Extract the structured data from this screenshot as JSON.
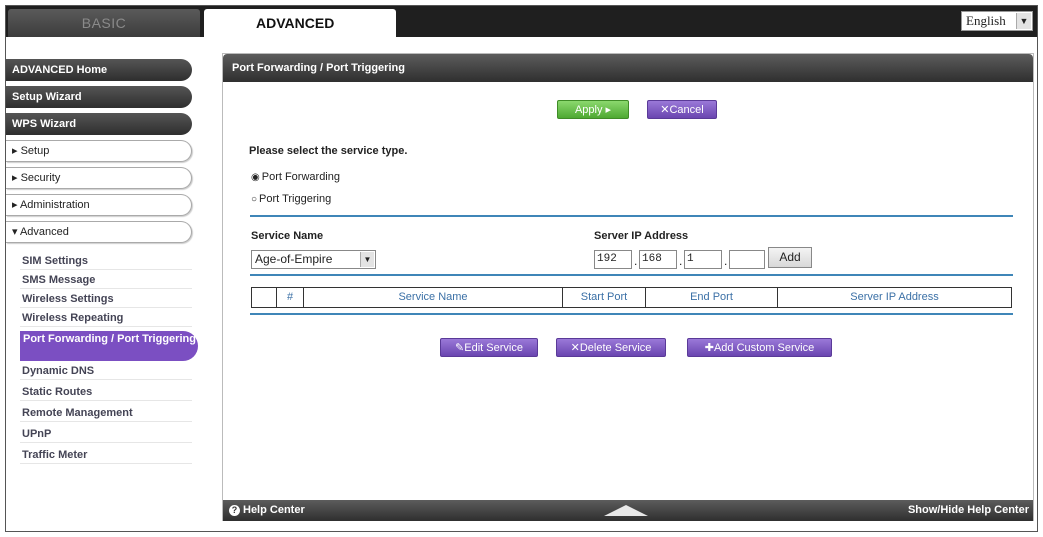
{
  "tabs": {
    "basic": "BASIC",
    "advanced": "ADVANCED"
  },
  "language": {
    "selected": "English",
    "arrow": "▼"
  },
  "sidebar": {
    "main_items": [
      "ADVANCED Home",
      "Setup Wizard",
      "WPS Wizard"
    ],
    "sections": [
      "▸ Setup",
      "▸ Security",
      "▸ Administration",
      "▾ Advanced"
    ],
    "sub_items": [
      "SIM Settings",
      "SMS Message",
      "Wireless Settings",
      "Wireless Repeating",
      "Port Forwarding / Port Triggering",
      "Dynamic DNS",
      "Static Routes",
      "Remote Management",
      "UPnP",
      "Traffic Meter"
    ]
  },
  "panel": {
    "title": "Port Forwarding / Port Triggering",
    "apply_label": "Apply ▸",
    "cancel_label": "✕Cancel",
    "service_type_prompt": "Please select the service type.",
    "option_port_forwarding": "Port Forwarding",
    "option_port_triggering": "Port Triggering",
    "selected_option": "port_forwarding",
    "service_name_label": "Service Name",
    "service_name_value": "Age-of-Empire",
    "server_ip_label": "Server IP Address",
    "server_ip": [
      "192",
      "168",
      "1",
      ""
    ],
    "add_label": "Add",
    "table_headers": [
      "",
      "#",
      "Service Name",
      "Start Port",
      "End Port",
      "Server IP Address"
    ],
    "edit_service_label": "✎Edit Service",
    "delete_service_label": "✕Delete Service",
    "add_custom_service_label": "✚Add Custom Service",
    "help_center_label": "Help Center",
    "show_hide_help_label": "Show/Hide Help Center"
  },
  "colors": {
    "accent_purple": "#7b4fc2",
    "apply_green": "#4ea932",
    "rule_blue": "#3f86b8"
  }
}
